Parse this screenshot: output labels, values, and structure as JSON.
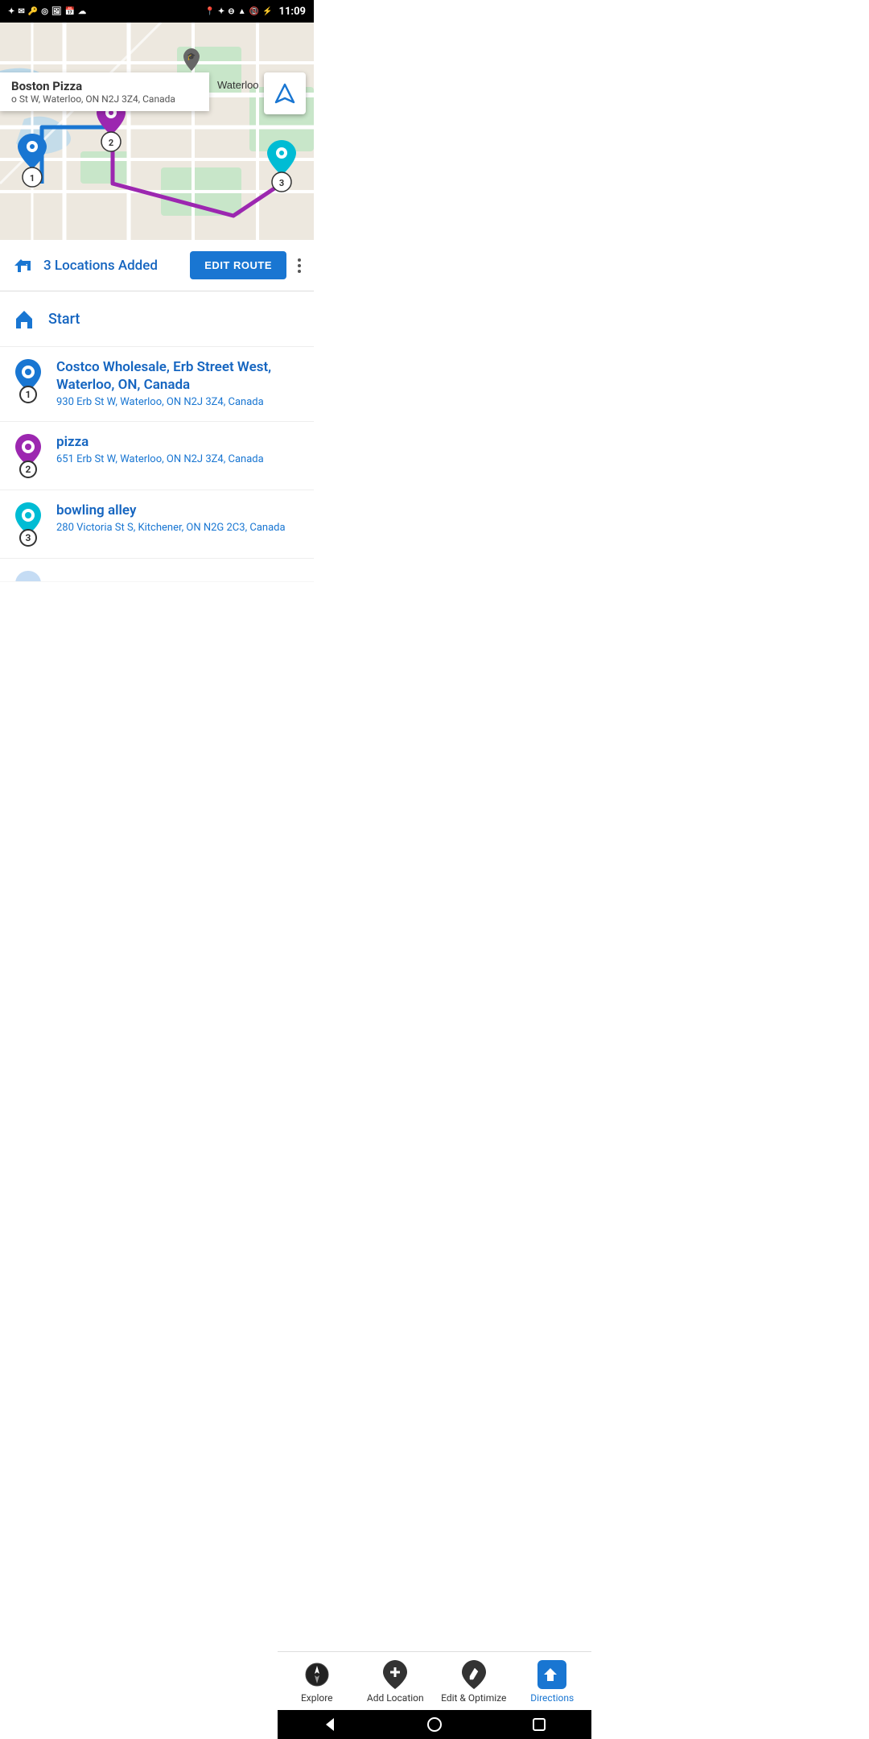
{
  "statusBar": {
    "time": "11:09",
    "icons": [
      "notifications",
      "mail",
      "key",
      "circle",
      "image",
      "calendar",
      "cloud",
      "location",
      "bluetooth",
      "minus-circle",
      "wifi",
      "signal-off",
      "battery"
    ]
  },
  "map": {
    "infoCard": {
      "placeName": "Boston Pizza",
      "placeAddress": "o St W, Waterloo, ON N2J 3Z4, Canada"
    },
    "locationLabel": "Waterloo"
  },
  "locationsBar": {
    "countText": "3 Locations Added",
    "editRouteLabel": "EDIT ROUTE"
  },
  "routeList": {
    "startLabel": "Start",
    "items": [
      {
        "id": 1,
        "color": "#1976D2",
        "name": "Costco Wholesale, Erb Street West, Waterloo, ON, Canada",
        "address": "930 Erb St W, Waterloo, ON N2J 3Z4, Canada"
      },
      {
        "id": 2,
        "color": "#9C27B0",
        "name": "pizza",
        "address": "651 Erb St W, Waterloo, ON N2J 3Z4, Canada"
      },
      {
        "id": 3,
        "color": "#00BCD4",
        "name": "bowling alley",
        "address": "280 Victoria St S, Kitchener, ON N2G 2C3, Canada"
      }
    ]
  },
  "bottomNav": {
    "items": [
      {
        "id": "explore",
        "label": "Explore",
        "active": false
      },
      {
        "id": "add-location",
        "label": "Add Location",
        "active": false
      },
      {
        "id": "edit-optimize",
        "label": "Edit & Optimize",
        "active": false
      },
      {
        "id": "directions",
        "label": "Directions",
        "active": true
      }
    ]
  }
}
